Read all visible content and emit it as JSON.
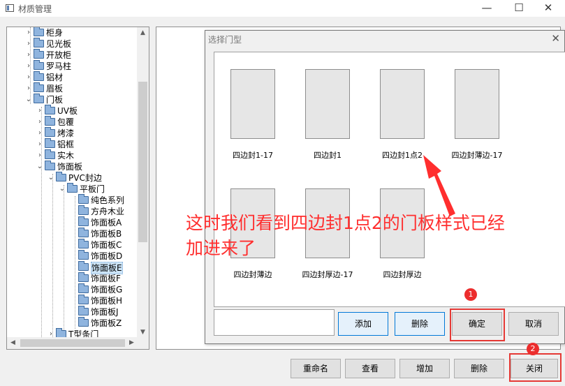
{
  "window": {
    "title": "材质管理",
    "minimize": "—",
    "maximize": "☐",
    "close": "✕"
  },
  "tree": {
    "items": [
      {
        "label": "柜身",
        "expander": "›"
      },
      {
        "label": "见光板",
        "expander": "›"
      },
      {
        "label": "开放柜",
        "expander": "›"
      },
      {
        "label": "罗马柱",
        "expander": "›"
      },
      {
        "label": "铝材",
        "expander": "›"
      },
      {
        "label": "眉板",
        "expander": "›"
      },
      {
        "label": "门板",
        "expander": "⌄"
      },
      {
        "label": "UV板",
        "expander": "›"
      },
      {
        "label": "包覆",
        "expander": "›"
      },
      {
        "label": "烤漆",
        "expander": "›"
      },
      {
        "label": "铝框",
        "expander": "›"
      },
      {
        "label": "实木",
        "expander": "›"
      },
      {
        "label": "饰面板",
        "expander": "⌄"
      },
      {
        "label": "PVC封边",
        "expander": "⌄"
      },
      {
        "label": "平板门",
        "expander": "⌄"
      },
      {
        "label": "纯色系列"
      },
      {
        "label": "方舟木业"
      },
      {
        "label": "饰面板A"
      },
      {
        "label": "饰面板B"
      },
      {
        "label": "饰面板C"
      },
      {
        "label": "饰面板D"
      },
      {
        "label": "饰面板E"
      },
      {
        "label": "饰面板F"
      },
      {
        "label": "饰面板G"
      },
      {
        "label": "饰面板H"
      },
      {
        "label": "饰面板J"
      },
      {
        "label": "饰面板Z"
      },
      {
        "label": "T型条门",
        "expander": "›"
      }
    ],
    "scroll_up": "▲",
    "scroll_down": "▼",
    "scroll_left": "◀",
    "scroll_right": "▶"
  },
  "buttons": {
    "rename": "重命名",
    "view": "查看",
    "add": "增加",
    "delete": "删除",
    "close": "关闭"
  },
  "dialog": {
    "title": "选择门型",
    "close": "✕",
    "items": [
      {
        "caption": "四边封1-17"
      },
      {
        "caption": "四边封1"
      },
      {
        "caption": "四边封1点2"
      },
      {
        "caption": "四边封薄边-17"
      },
      {
        "caption": "四边封薄边"
      },
      {
        "caption": "四边封厚边-17"
      },
      {
        "caption": "四边封厚边"
      }
    ],
    "buttons": {
      "add": "添加",
      "delete": "删除",
      "confirm": "确定",
      "cancel": "取消"
    }
  },
  "annotation": {
    "line1": "这时我们看到四边封1点2的门板样式已经",
    "line2": "加进来了",
    "badge1": "1",
    "badge2": "2",
    "color": "#ff2e2e"
  }
}
